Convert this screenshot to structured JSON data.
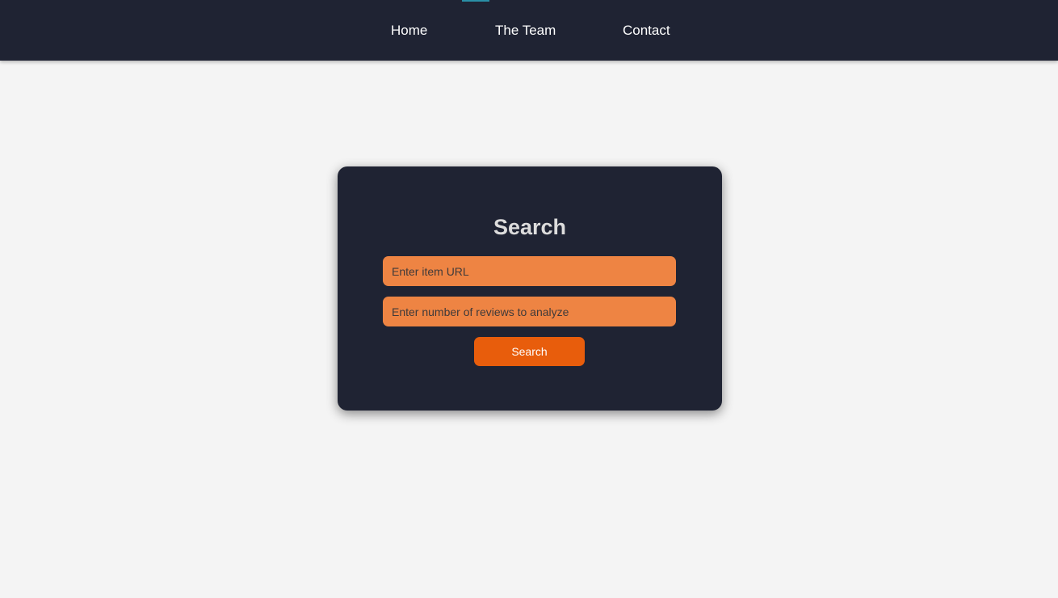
{
  "nav": {
    "items": [
      {
        "label": "Home"
      },
      {
        "label": "The Team"
      },
      {
        "label": "Contact"
      }
    ]
  },
  "search_card": {
    "title": "Search",
    "url_field": {
      "value": "",
      "placeholder": "Enter item URL"
    },
    "count_field": {
      "value": "",
      "placeholder": "Enter number of reviews to analyze"
    },
    "button_label": "Search"
  },
  "colors": {
    "nav_background": "#1f2333",
    "card_background": "#1f2333",
    "page_background": "#f4f4f4",
    "input_background": "#ee8443",
    "button_background": "#e85d0c",
    "accent": "#2a8fa6"
  }
}
